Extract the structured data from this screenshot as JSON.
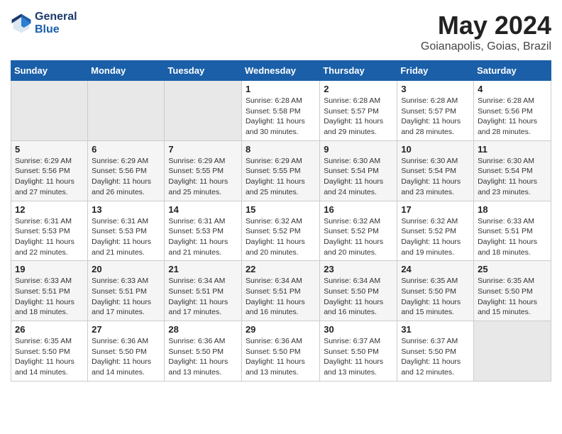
{
  "logo": {
    "line1": "General",
    "line2": "Blue"
  },
  "title": "May 2024",
  "location": "Goianapolis, Goias, Brazil",
  "weekdays": [
    "Sunday",
    "Monday",
    "Tuesday",
    "Wednesday",
    "Thursday",
    "Friday",
    "Saturday"
  ],
  "weeks": [
    [
      {
        "day": "",
        "info": ""
      },
      {
        "day": "",
        "info": ""
      },
      {
        "day": "",
        "info": ""
      },
      {
        "day": "1",
        "info": "Sunrise: 6:28 AM\nSunset: 5:58 PM\nDaylight: 11 hours and 30 minutes."
      },
      {
        "day": "2",
        "info": "Sunrise: 6:28 AM\nSunset: 5:57 PM\nDaylight: 11 hours and 29 minutes."
      },
      {
        "day": "3",
        "info": "Sunrise: 6:28 AM\nSunset: 5:57 PM\nDaylight: 11 hours and 28 minutes."
      },
      {
        "day": "4",
        "info": "Sunrise: 6:28 AM\nSunset: 5:56 PM\nDaylight: 11 hours and 28 minutes."
      }
    ],
    [
      {
        "day": "5",
        "info": "Sunrise: 6:29 AM\nSunset: 5:56 PM\nDaylight: 11 hours and 27 minutes."
      },
      {
        "day": "6",
        "info": "Sunrise: 6:29 AM\nSunset: 5:56 PM\nDaylight: 11 hours and 26 minutes."
      },
      {
        "day": "7",
        "info": "Sunrise: 6:29 AM\nSunset: 5:55 PM\nDaylight: 11 hours and 25 minutes."
      },
      {
        "day": "8",
        "info": "Sunrise: 6:29 AM\nSunset: 5:55 PM\nDaylight: 11 hours and 25 minutes."
      },
      {
        "day": "9",
        "info": "Sunrise: 6:30 AM\nSunset: 5:54 PM\nDaylight: 11 hours and 24 minutes."
      },
      {
        "day": "10",
        "info": "Sunrise: 6:30 AM\nSunset: 5:54 PM\nDaylight: 11 hours and 23 minutes."
      },
      {
        "day": "11",
        "info": "Sunrise: 6:30 AM\nSunset: 5:54 PM\nDaylight: 11 hours and 23 minutes."
      }
    ],
    [
      {
        "day": "12",
        "info": "Sunrise: 6:31 AM\nSunset: 5:53 PM\nDaylight: 11 hours and 22 minutes."
      },
      {
        "day": "13",
        "info": "Sunrise: 6:31 AM\nSunset: 5:53 PM\nDaylight: 11 hours and 21 minutes."
      },
      {
        "day": "14",
        "info": "Sunrise: 6:31 AM\nSunset: 5:53 PM\nDaylight: 11 hours and 21 minutes."
      },
      {
        "day": "15",
        "info": "Sunrise: 6:32 AM\nSunset: 5:52 PM\nDaylight: 11 hours and 20 minutes."
      },
      {
        "day": "16",
        "info": "Sunrise: 6:32 AM\nSunset: 5:52 PM\nDaylight: 11 hours and 20 minutes."
      },
      {
        "day": "17",
        "info": "Sunrise: 6:32 AM\nSunset: 5:52 PM\nDaylight: 11 hours and 19 minutes."
      },
      {
        "day": "18",
        "info": "Sunrise: 6:33 AM\nSunset: 5:51 PM\nDaylight: 11 hours and 18 minutes."
      }
    ],
    [
      {
        "day": "19",
        "info": "Sunrise: 6:33 AM\nSunset: 5:51 PM\nDaylight: 11 hours and 18 minutes."
      },
      {
        "day": "20",
        "info": "Sunrise: 6:33 AM\nSunset: 5:51 PM\nDaylight: 11 hours and 17 minutes."
      },
      {
        "day": "21",
        "info": "Sunrise: 6:34 AM\nSunset: 5:51 PM\nDaylight: 11 hours and 17 minutes."
      },
      {
        "day": "22",
        "info": "Sunrise: 6:34 AM\nSunset: 5:51 PM\nDaylight: 11 hours and 16 minutes."
      },
      {
        "day": "23",
        "info": "Sunrise: 6:34 AM\nSunset: 5:50 PM\nDaylight: 11 hours and 16 minutes."
      },
      {
        "day": "24",
        "info": "Sunrise: 6:35 AM\nSunset: 5:50 PM\nDaylight: 11 hours and 15 minutes."
      },
      {
        "day": "25",
        "info": "Sunrise: 6:35 AM\nSunset: 5:50 PM\nDaylight: 11 hours and 15 minutes."
      }
    ],
    [
      {
        "day": "26",
        "info": "Sunrise: 6:35 AM\nSunset: 5:50 PM\nDaylight: 11 hours and 14 minutes."
      },
      {
        "day": "27",
        "info": "Sunrise: 6:36 AM\nSunset: 5:50 PM\nDaylight: 11 hours and 14 minutes."
      },
      {
        "day": "28",
        "info": "Sunrise: 6:36 AM\nSunset: 5:50 PM\nDaylight: 11 hours and 13 minutes."
      },
      {
        "day": "29",
        "info": "Sunrise: 6:36 AM\nSunset: 5:50 PM\nDaylight: 11 hours and 13 minutes."
      },
      {
        "day": "30",
        "info": "Sunrise: 6:37 AM\nSunset: 5:50 PM\nDaylight: 11 hours and 13 minutes."
      },
      {
        "day": "31",
        "info": "Sunrise: 6:37 AM\nSunset: 5:50 PM\nDaylight: 11 hours and 12 minutes."
      },
      {
        "day": "",
        "info": ""
      }
    ]
  ]
}
